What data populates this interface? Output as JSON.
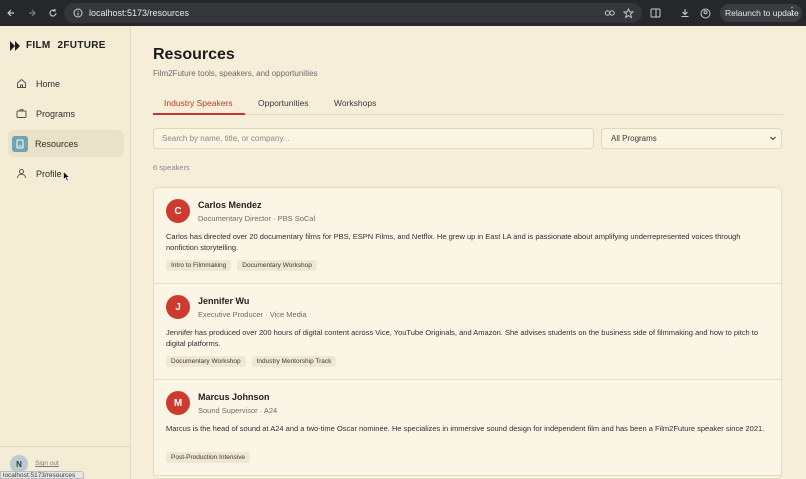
{
  "browser": {
    "url": "localhost:5173/resources",
    "relaunch_label": "Relaunch to update",
    "status_url": "localhost:5173/resources"
  },
  "sidebar": {
    "logo_film": "FILM",
    "logo_future": "2FUTURE",
    "items": [
      {
        "label": "Home",
        "icon": "home-icon"
      },
      {
        "label": "Programs",
        "icon": "briefcase-icon"
      },
      {
        "label": "Resources",
        "icon": "book-icon"
      },
      {
        "label": "Profile",
        "icon": "user-icon"
      }
    ],
    "avatar_initial": "N",
    "signout_label": "Sign out"
  },
  "page": {
    "title": "Resources",
    "subtitle": "Film2Future tools, speakers, and opportunities",
    "tabs": [
      "Industry Speakers",
      "Opportunities",
      "Workshops"
    ],
    "search_placeholder": "Search by name, title, or company...",
    "program_filter": "All Programs",
    "count_text": "6 speakers"
  },
  "speakers": [
    {
      "initial": "C",
      "name": "Carlos Mendez",
      "role": "Documentary Director · PBS SoCal",
      "bio": "Carlos has directed over 20 documentary films for PBS, ESPN Films, and Netflix. He grew up in East LA and is passionate about amplifying underrepresented voices through nonfiction storytelling.",
      "tags": [
        "Intro to Filmmaking",
        "Documentary Workshop"
      ]
    },
    {
      "initial": "J",
      "name": "Jennifer Wu",
      "role": "Executive Producer · Vice Media",
      "bio": "Jennifer has produced over 200 hours of digital content across Vice, YouTube Originals, and Amazon. She advises students on the business side of filmmaking and how to pitch to digital platforms.",
      "tags": [
        "Documentary Workshop",
        "Industry Mentorship Track"
      ]
    },
    {
      "initial": "M",
      "name": "Marcus Johnson",
      "role": "Sound Supervisor · A24",
      "bio": "Marcus is the head of sound at A24 and a two-time Oscar nominee. He specializes in immersive sound design for independent film and has been a Film2Future speaker since 2021.",
      "tags": [
        "Post-Production Intensive"
      ]
    }
  ],
  "colors": {
    "accent": "#c0392b",
    "avatar_red": "#cd3b2e",
    "background": "#f6eed8",
    "active_icon": "#6fa3b3"
  }
}
